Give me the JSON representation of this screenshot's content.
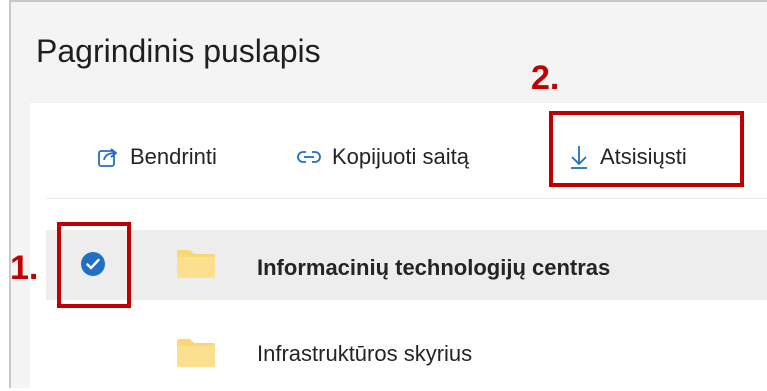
{
  "page": {
    "title": "Pagrindinis puslapis"
  },
  "toolbar": {
    "share_label": "Bendrinti",
    "share_icon": "share-icon",
    "copylink_label": "Kopijuoti saitą",
    "copylink_icon": "link-icon",
    "download_label": "Atsisiųsti",
    "download_icon": "download-arrow-icon"
  },
  "items": [
    {
      "name": "Informacinių technologijų centras",
      "selected": true,
      "type": "folder"
    },
    {
      "name": "Infrastruktūros skyrius",
      "selected": false,
      "type": "folder"
    }
  ],
  "callouts": {
    "first": "1.",
    "second": "2."
  },
  "colors": {
    "accent": "#1f6fc5",
    "callout": "#c00000",
    "folder": "#f8d775",
    "selected_row": "#ededed"
  }
}
